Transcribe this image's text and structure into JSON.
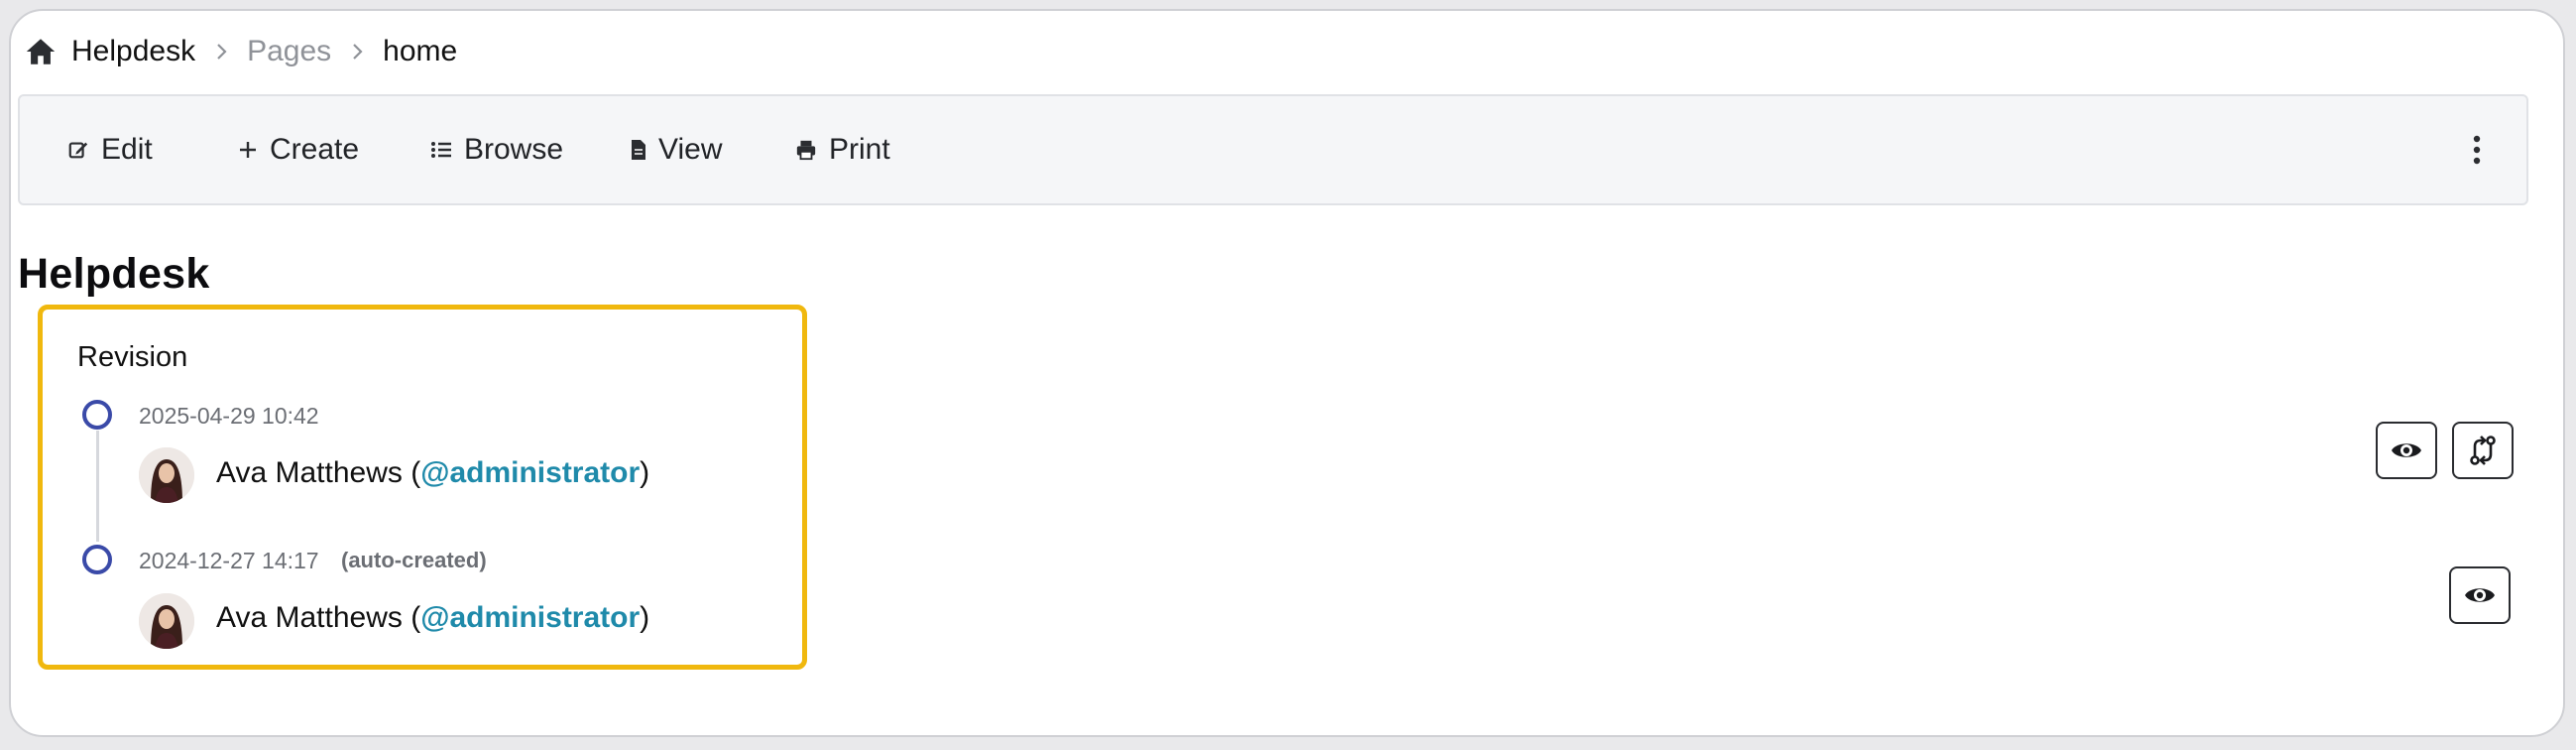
{
  "breadcrumb": {
    "root": "Helpdesk",
    "middle": "Pages",
    "current": "home"
  },
  "toolbar": {
    "edit_label": "Edit",
    "create_label": "Create",
    "browse_label": "Browse",
    "view_label": "View",
    "print_label": "Print"
  },
  "page": {
    "title": "Helpdesk"
  },
  "revisions": {
    "heading": "Revision",
    "items": [
      {
        "date": "2025-04-29 10:42",
        "flag": "",
        "user_name": "Ava Matthews (",
        "user_handle": "@administrator",
        "user_suffix": ")"
      },
      {
        "date": "2024-12-27 14:17",
        "flag": "(auto-created)",
        "user_name": "Ava Matthews (",
        "user_handle": "@administrator",
        "user_suffix": ")"
      }
    ]
  },
  "icons": {
    "home": "home-icon",
    "edit": "edit-icon",
    "create": "plus-icon",
    "browse": "list-icon",
    "view": "document-icon",
    "print": "printer-icon",
    "more": "more-vertical-icon",
    "preview": "eye-icon",
    "compare": "compare-icon"
  },
  "colors": {
    "highlight": "#f0b80e",
    "timeline_dot": "#3a4aa8",
    "handle": "#1f8aaa"
  }
}
